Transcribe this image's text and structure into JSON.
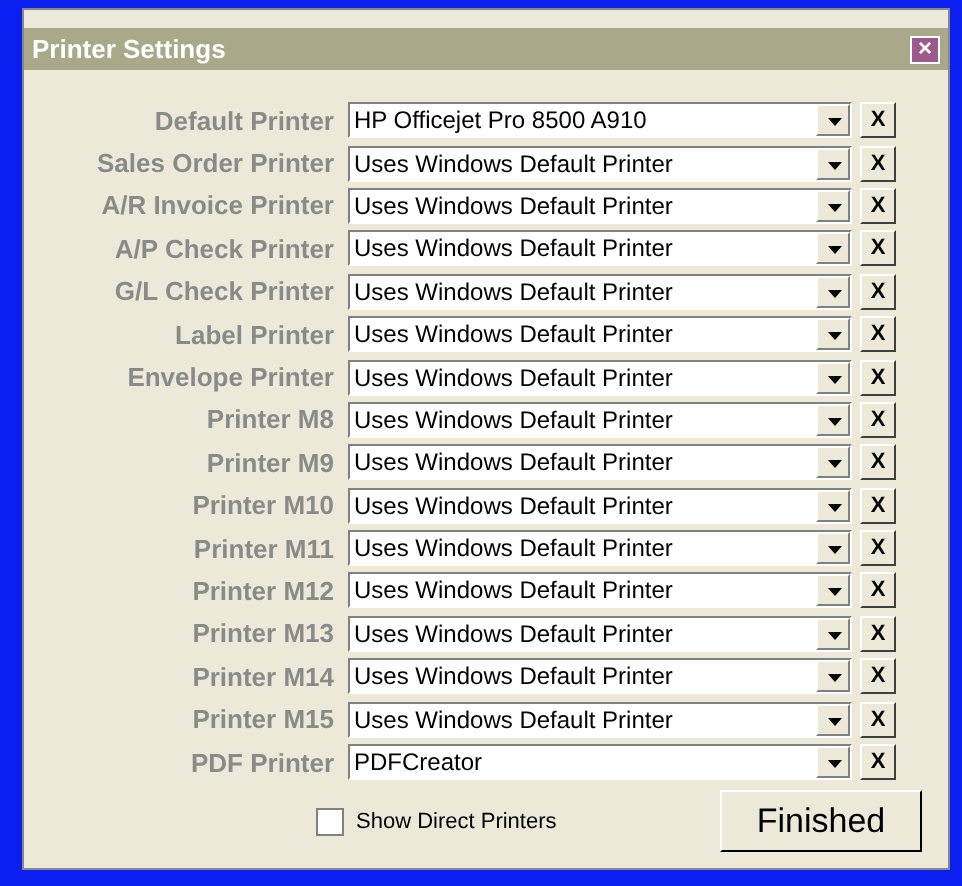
{
  "window": {
    "title": "Printer Settings",
    "close": "×"
  },
  "printers": [
    {
      "label": "Default Printer",
      "value": "HP Officejet Pro 8500 A910",
      "clear_button": "X"
    },
    {
      "label": "Sales Order Printer",
      "value": "Uses Windows Default Printer",
      "clear_button": "X"
    },
    {
      "label": "A/R Invoice Printer",
      "value": "Uses Windows Default Printer",
      "clear_button": "X"
    },
    {
      "label": "A/P Check Printer",
      "value": "Uses Windows Default Printer",
      "clear_button": "X"
    },
    {
      "label": "G/L Check Printer",
      "value": "Uses Windows Default Printer",
      "clear_button": "X"
    },
    {
      "label": "Label Printer",
      "value": "Uses Windows Default Printer",
      "clear_button": "X"
    },
    {
      "label": "Envelope Printer",
      "value": "Uses Windows Default Printer",
      "clear_button": "X"
    },
    {
      "label": "Printer M8",
      "value": "Uses Windows Default Printer",
      "clear_button": "X"
    },
    {
      "label": "Printer M9",
      "value": "Uses Windows Default Printer",
      "clear_button": "X"
    },
    {
      "label": "Printer M10",
      "value": "Uses Windows Default Printer",
      "clear_button": "X"
    },
    {
      "label": "Printer M11",
      "value": "Uses Windows Default Printer",
      "clear_button": "X"
    },
    {
      "label": "Printer M12",
      "value": "Uses Windows Default Printer",
      "clear_button": "X"
    },
    {
      "label": "Printer M13",
      "value": "Uses Windows Default Printer",
      "clear_button": "X"
    },
    {
      "label": "Printer M14",
      "value": "Uses Windows Default Printer",
      "clear_button": "X"
    },
    {
      "label": "Printer M15",
      "value": "Uses Windows Default Printer",
      "clear_button": "X"
    },
    {
      "label": "PDF Printer",
      "value": "PDFCreator",
      "clear_button": "X"
    }
  ],
  "show_direct_printers": {
    "label": "Show Direct Printers",
    "checked": false
  },
  "finished_button": "Finished"
}
